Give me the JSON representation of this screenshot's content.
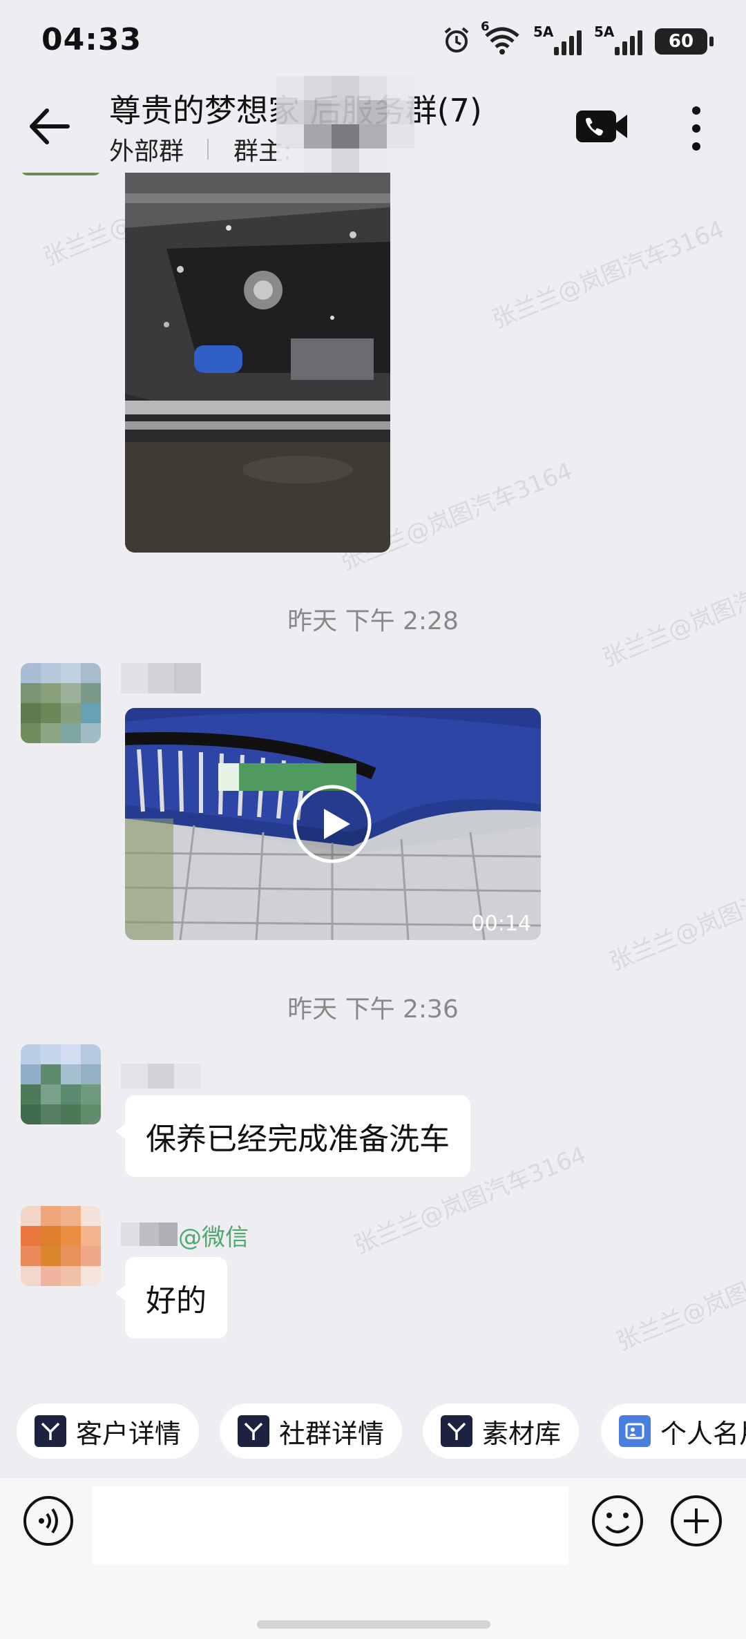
{
  "status_bar": {
    "time": "04:33",
    "signal1_label": "5A",
    "signal2_label": "5A",
    "wifi_label": "6",
    "battery": "60"
  },
  "header": {
    "title": "尊贵的梦想家 后服务群(7)",
    "external_label": "外部群",
    "owner_label": "群主:",
    "icons": [
      "back-arrow-icon",
      "video-call-icon",
      "more-vertical-icon"
    ]
  },
  "chat": {
    "timestamp_1": "昨天 下午 2:28",
    "video_duration": "00:14",
    "timestamp_2": "昨天 下午 2:36",
    "message_1": "保养已经完成准备洗车",
    "sender_suffix": "@微信",
    "message_2": "好的",
    "watermark": "张兰兰@岚图汽车3164"
  },
  "quick_actions": {
    "items": [
      {
        "label": "客户详情",
        "icon": "voyah-logo-icon"
      },
      {
        "label": "社群详情",
        "icon": "voyah-logo-icon"
      },
      {
        "label": "素材库",
        "icon": "voyah-logo-icon"
      },
      {
        "label": "个人名片",
        "icon": "profile-card-icon"
      }
    ]
  },
  "input_bar": {
    "placeholder": "",
    "icons": [
      "voice-icon",
      "emoji-icon",
      "plus-icon"
    ]
  },
  "colors": {
    "background": "#ededf2",
    "bubble": "#ffffff",
    "wechat_green": "#4fa96b",
    "chip_icon_dark": "#1c2340",
    "chip_icon_blue": "#4a7fe0"
  }
}
